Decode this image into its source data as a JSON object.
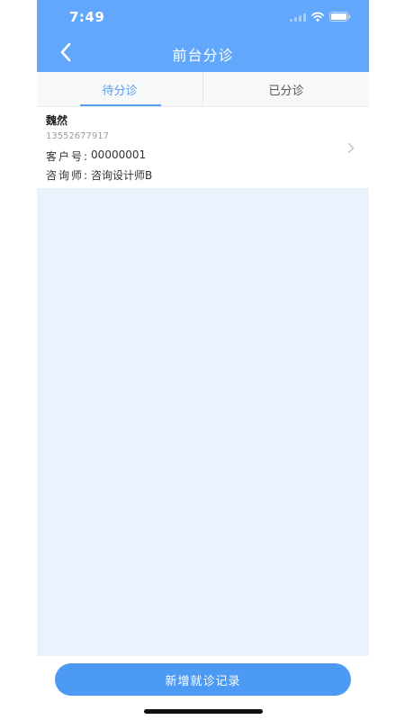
{
  "status_bar": {
    "time": "7:49",
    "icons": [
      "signal-icon",
      "wifi-icon",
      "battery-icon"
    ]
  },
  "nav": {
    "title": "前台分诊",
    "back_icon": "chevron-left-icon"
  },
  "tabs": [
    {
      "label": "待分诊",
      "active": true
    },
    {
      "label": "已分诊",
      "active": false
    }
  ],
  "patients": [
    {
      "name": "魏然",
      "phone": "13552677917",
      "customer_label": "客户号:",
      "customer_no": "00000001",
      "consultant_label": "咨询师:",
      "consultant": "咨询设计师B"
    }
  ],
  "footer": {
    "add_button_label": "新增就诊记录"
  },
  "colors": {
    "header": "#61a7fb",
    "accent": "#5a9cf0",
    "button": "#4d9af5",
    "list_background": "#e8f3fe"
  }
}
